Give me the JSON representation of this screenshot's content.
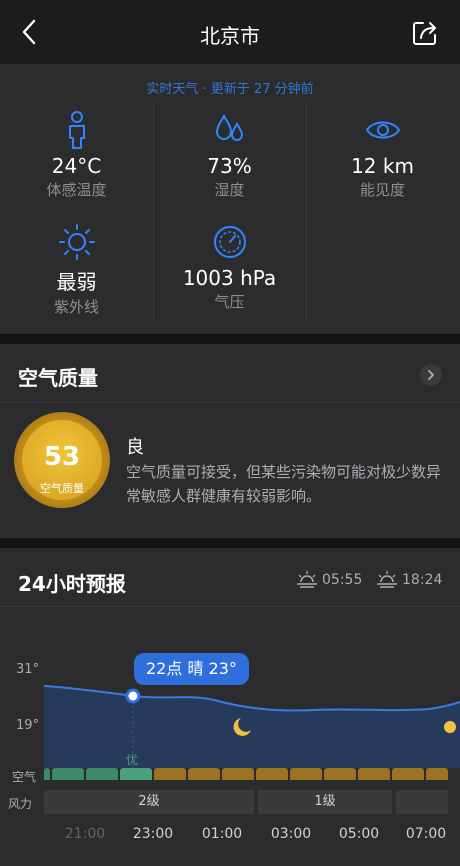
{
  "header": {
    "title": "北京市",
    "back_icon": "chevron-left-icon",
    "share_icon": "share-icon"
  },
  "realtime": {
    "updated": "实时天气 · 更新于 27 分钟前",
    "cells": [
      {
        "value": "24°C",
        "label": "体感温度",
        "icon": "person-icon"
      },
      {
        "value": "73%",
        "label": "湿度",
        "icon": "drops-icon"
      },
      {
        "value": "12 km",
        "label": "能见度",
        "icon": "eye-icon"
      },
      {
        "value": "最弱",
        "label": "紫外线",
        "icon": "sun-icon"
      },
      {
        "value": "1003 hPa",
        "label": "气压",
        "icon": "gauge-icon"
      }
    ]
  },
  "air": {
    "title": "空气质量",
    "aqi": "53",
    "aqi_label": "空气质量",
    "level": "良",
    "description": "空气质量可接受，但某些污染物可能对极少数异常敏感人群健康有较弱影响。"
  },
  "forecast": {
    "title": "24小时预报",
    "sunrise": "05:55",
    "sunset": "18:24",
    "tooltip": "22点 晴 23°",
    "y_high": "31°",
    "y_low": "19°",
    "air_row_label": "空气",
    "air_first_label": "优",
    "wind_row_label": "风力",
    "wind": [
      "2级",
      "1级"
    ],
    "times": [
      "21:00",
      "23:00",
      "01:00",
      "03:00",
      "05:00",
      "07:00"
    ],
    "colors": {
      "good": "#3e8a6a",
      "good_active": "#49a07d",
      "moderate": "#9a7420",
      "line": "#3d7ae0",
      "fill": "#263a5c"
    }
  }
}
